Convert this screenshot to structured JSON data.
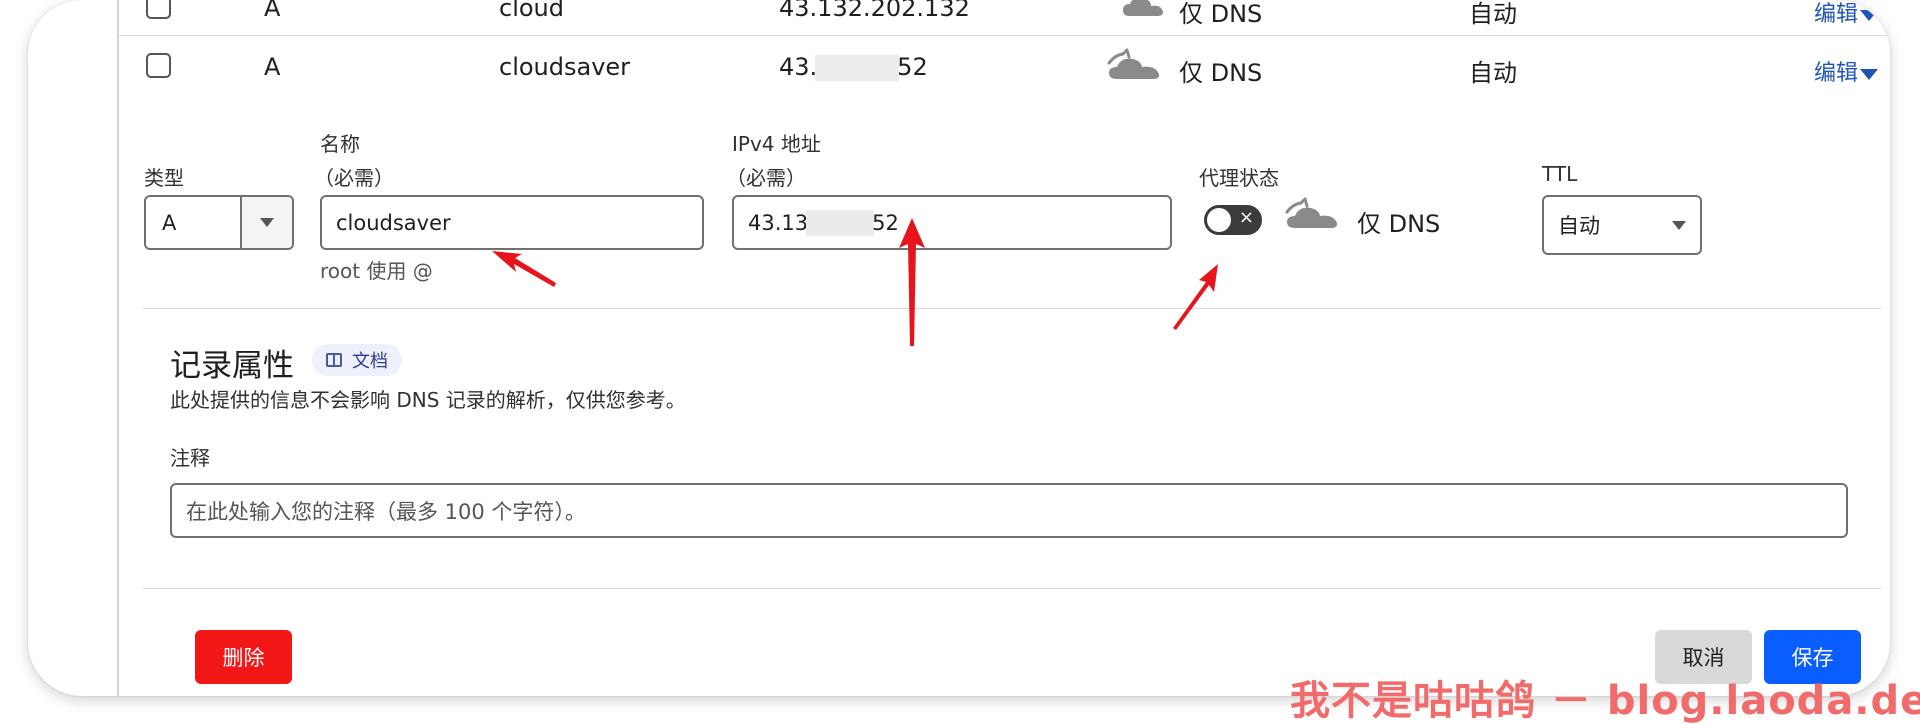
{
  "previous_row": {
    "type": "A",
    "name": "cloud",
    "content": "43.132.202.132",
    "proxy": "仅 DNS",
    "ttl": "自动",
    "edit": "编辑"
  },
  "current_row": {
    "type": "A",
    "name": "cloudsaver",
    "content_prefix": "43.",
    "content_suffix": "52",
    "proxy": "仅 DNS",
    "ttl": "自动",
    "edit": "编辑"
  },
  "form": {
    "type_label": "类型",
    "type_value": "A",
    "name_label": "名称",
    "name_required": "（必需）",
    "name_value": "cloudsaver",
    "name_hint": "root 使用 @",
    "ipv4_label": "IPv4 地址",
    "ipv4_required": "（必需）",
    "ipv4_prefix": "43.13",
    "ipv4_suffix": "52",
    "proxy_label": "代理状态",
    "proxy_value": "仅 DNS",
    "ttl_label": "TTL",
    "ttl_value": "自动"
  },
  "record_attributes": {
    "title": "记录属性",
    "doc_badge": "文档",
    "description": "此处提供的信息不会影响 DNS 记录的解析，仅供您参考。",
    "comment_label": "注释",
    "comment_placeholder": "在此处输入您的注释（最多 100 个字符）。"
  },
  "actions": {
    "delete": "删除",
    "cancel": "取消",
    "save": "保存"
  },
  "watermark": "我不是咕咕鸽 － blog.laoda.de",
  "colors": {
    "danger": "#f31616",
    "primary": "#0a5dff",
    "link": "#1f55b4",
    "annotation_arrow": "#e8141b",
    "watermark": "#f26b6b"
  }
}
